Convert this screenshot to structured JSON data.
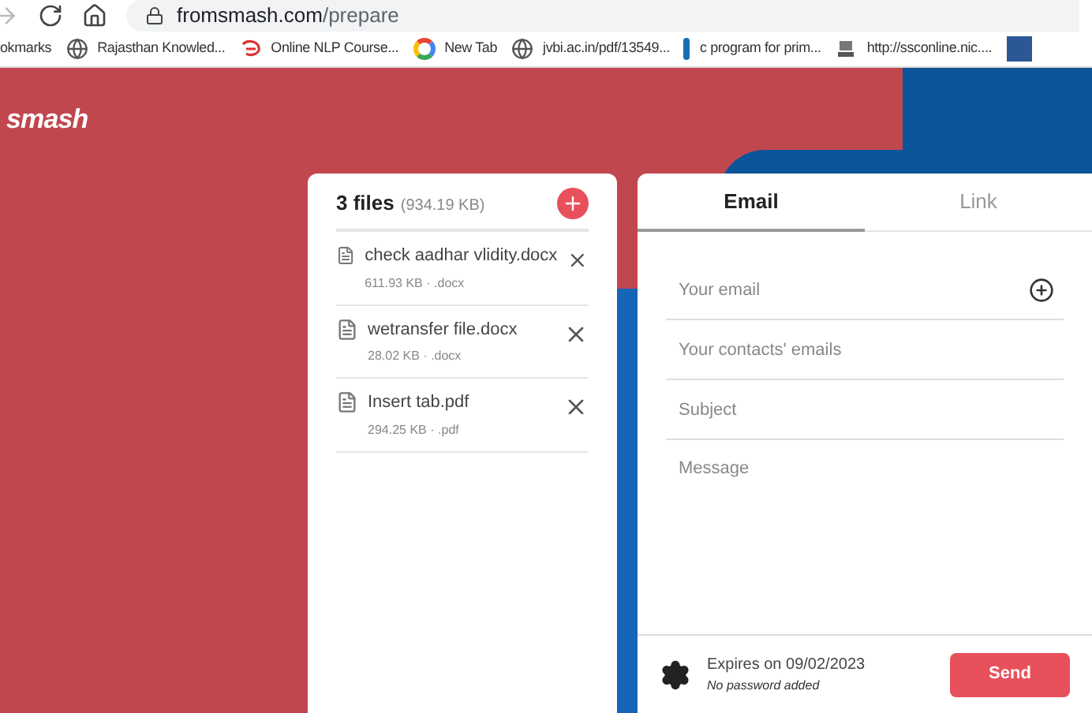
{
  "browser": {
    "url_domain": "fromsmash.com",
    "url_path": "/prepare"
  },
  "bookmarks": [
    {
      "kind": "folder",
      "label": "okmarks"
    },
    {
      "kind": "globe",
      "label": "Rajasthan Knowled..."
    },
    {
      "kind": "nlp",
      "label": "Online NLP Course..."
    },
    {
      "kind": "google",
      "label": "New Tab"
    },
    {
      "kind": "globe",
      "label": "jvbi.ac.in/pdf/13549..."
    },
    {
      "kind": "pin",
      "label": "c program for prim..."
    },
    {
      "kind": "emblem",
      "label": "http://ssconline.nic...."
    },
    {
      "kind": "word"
    }
  ],
  "logo": "smash",
  "files_panel": {
    "title": "3 files",
    "total": "(934.19 KB)",
    "files": [
      {
        "name": "check aadhar vlidity.docx",
        "size": "611.93 KB",
        "sep": "·",
        "ext": ".docx"
      },
      {
        "name": "wetransfer file.docx",
        "size": "28.02 KB",
        "sep": "·",
        "ext": ".docx"
      },
      {
        "name": "Insert tab.pdf",
        "size": "294.25 KB",
        "sep": "·",
        "ext": ".pdf"
      }
    ]
  },
  "send_panel": {
    "tabs": [
      {
        "label": "Email",
        "selected": true
      },
      {
        "label": "Link",
        "selected": false
      }
    ],
    "fields": [
      {
        "placeholder": "Your email",
        "kind": "add"
      },
      {
        "placeholder": "Your contacts' emails",
        "kind": "plain"
      },
      {
        "placeholder": "Subject",
        "kind": "plain"
      },
      {
        "placeholder": "Message",
        "kind": "textarea"
      }
    ],
    "expiry": "Expires on 09/02/2023",
    "password": "No password added",
    "send": "Send"
  }
}
